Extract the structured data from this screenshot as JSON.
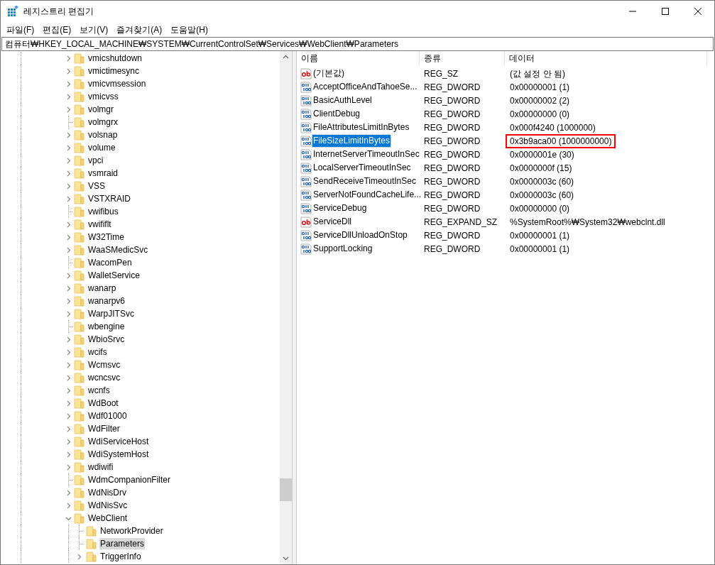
{
  "window": {
    "title": "레지스트리 편집기"
  },
  "menu": [
    "파일(F)",
    "편집(E)",
    "보기(V)",
    "즐겨찾기(A)",
    "도움말(H)"
  ],
  "address": "컴퓨터₩HKEY_LOCAL_MACHINE₩SYSTEM₩CurrentControlSet₩Services₩WebClient₩Parameters",
  "tree": [
    {
      "label": "vmicshutdown",
      "expandable": true,
      "selected": false
    },
    {
      "label": "vmictimesync",
      "expandable": true,
      "selected": false
    },
    {
      "label": "vmicvmsession",
      "expandable": true,
      "selected": false
    },
    {
      "label": "vmicvss",
      "expandable": true,
      "selected": false
    },
    {
      "label": "volmgr",
      "expandable": true,
      "selected": false
    },
    {
      "label": "volmgrx",
      "expandable": false,
      "selected": false
    },
    {
      "label": "volsnap",
      "expandable": true,
      "selected": false
    },
    {
      "label": "volume",
      "expandable": true,
      "selected": false
    },
    {
      "label": "vpci",
      "expandable": true,
      "selected": false
    },
    {
      "label": "vsmraid",
      "expandable": true,
      "selected": false
    },
    {
      "label": "VSS",
      "expandable": true,
      "selected": false
    },
    {
      "label": "VSTXRAID",
      "expandable": true,
      "selected": false
    },
    {
      "label": "vwifibus",
      "expandable": false,
      "selected": false
    },
    {
      "label": "vwififlt",
      "expandable": true,
      "selected": false
    },
    {
      "label": "W32Time",
      "expandable": true,
      "selected": false
    },
    {
      "label": "WaaSMedicSvc",
      "expandable": true,
      "selected": false
    },
    {
      "label": "WacomPen",
      "expandable": false,
      "selected": false
    },
    {
      "label": "WalletService",
      "expandable": true,
      "selected": false
    },
    {
      "label": "wanarp",
      "expandable": true,
      "selected": false
    },
    {
      "label": "wanarpv6",
      "expandable": true,
      "selected": false
    },
    {
      "label": "WarpJITSvc",
      "expandable": true,
      "selected": false
    },
    {
      "label": "wbengine",
      "expandable": false,
      "selected": false
    },
    {
      "label": "WbioSrvc",
      "expandable": true,
      "selected": false
    },
    {
      "label": "wcifs",
      "expandable": true,
      "selected": false
    },
    {
      "label": "Wcmsvc",
      "expandable": true,
      "selected": false
    },
    {
      "label": "wcncsvc",
      "expandable": true,
      "selected": false
    },
    {
      "label": "wcnfs",
      "expandable": true,
      "selected": false
    },
    {
      "label": "WdBoot",
      "expandable": true,
      "selected": false
    },
    {
      "label": "Wdf01000",
      "expandable": true,
      "selected": false
    },
    {
      "label": "WdFilter",
      "expandable": true,
      "selected": false
    },
    {
      "label": "WdiServiceHost",
      "expandable": true,
      "selected": false
    },
    {
      "label": "WdiSystemHost",
      "expandable": true,
      "selected": false
    },
    {
      "label": "wdiwifi",
      "expandable": true,
      "selected": false
    },
    {
      "label": "WdmCompanionFilter",
      "expandable": false,
      "selected": false
    },
    {
      "label": "WdNisDrv",
      "expandable": true,
      "selected": false
    },
    {
      "label": "WdNisSvc",
      "expandable": true,
      "selected": false
    },
    {
      "label": "WebClient",
      "expandable": true,
      "expanded": true,
      "selected": false,
      "children": [
        {
          "label": "NetworkProvider",
          "expandable": false,
          "selected": false
        },
        {
          "label": "Parameters",
          "expandable": false,
          "selected": true
        },
        {
          "label": "TriggerInfo",
          "expandable": true,
          "selected": false
        }
      ]
    }
  ],
  "table": {
    "columns": [
      "이름",
      "종류",
      "데이터"
    ],
    "rows": [
      {
        "kind": "string",
        "name": "(기본값)",
        "type": "REG_SZ",
        "data": "(값 설정 안 됨)",
        "selected": false,
        "highlighted": false
      },
      {
        "kind": "dword",
        "name": "AcceptOfficeAndTahoeSe...",
        "type": "REG_DWORD",
        "data": "0x00000001 (1)",
        "selected": false,
        "highlighted": false
      },
      {
        "kind": "dword",
        "name": "BasicAuthLevel",
        "type": "REG_DWORD",
        "data": "0x00000002 (2)",
        "selected": false,
        "highlighted": false
      },
      {
        "kind": "dword",
        "name": "ClientDebug",
        "type": "REG_DWORD",
        "data": "0x00000000 (0)",
        "selected": false,
        "highlighted": false
      },
      {
        "kind": "dword",
        "name": "FileAttributesLimitInBytes",
        "type": "REG_DWORD",
        "data": "0x000f4240 (1000000)",
        "selected": false,
        "highlighted": false
      },
      {
        "kind": "dword",
        "name": "FileSizeLimitInBytes",
        "type": "REG_DWORD",
        "data": "0x3b9aca00 (1000000000)",
        "selected": true,
        "highlighted": true
      },
      {
        "kind": "dword",
        "name": "InternetServerTimeoutInSec",
        "type": "REG_DWORD",
        "data": "0x0000001e (30)",
        "selected": false,
        "highlighted": false
      },
      {
        "kind": "dword",
        "name": "LocalServerTimeoutInSec",
        "type": "REG_DWORD",
        "data": "0x0000000f (15)",
        "selected": false,
        "highlighted": false
      },
      {
        "kind": "dword",
        "name": "SendReceiveTimeoutInSec",
        "type": "REG_DWORD",
        "data": "0x0000003c (60)",
        "selected": false,
        "highlighted": false
      },
      {
        "kind": "dword",
        "name": "ServerNotFoundCacheLife...",
        "type": "REG_DWORD",
        "data": "0x0000003c (60)",
        "selected": false,
        "highlighted": false
      },
      {
        "kind": "dword",
        "name": "ServiceDebug",
        "type": "REG_DWORD",
        "data": "0x00000000 (0)",
        "selected": false,
        "highlighted": false
      },
      {
        "kind": "string",
        "name": "ServiceDll",
        "type": "REG_EXPAND_SZ",
        "data": "%SystemRoot%₩System32₩webclnt.dll",
        "selected": false,
        "highlighted": false
      },
      {
        "kind": "dword",
        "name": "ServiceDllUnloadOnStop",
        "type": "REG_DWORD",
        "data": "0x00000001 (1)",
        "selected": false,
        "highlighted": false
      },
      {
        "kind": "dword",
        "name": "SupportLocking",
        "type": "REG_DWORD",
        "data": "0x00000001 (1)",
        "selected": false,
        "highlighted": false
      }
    ]
  }
}
